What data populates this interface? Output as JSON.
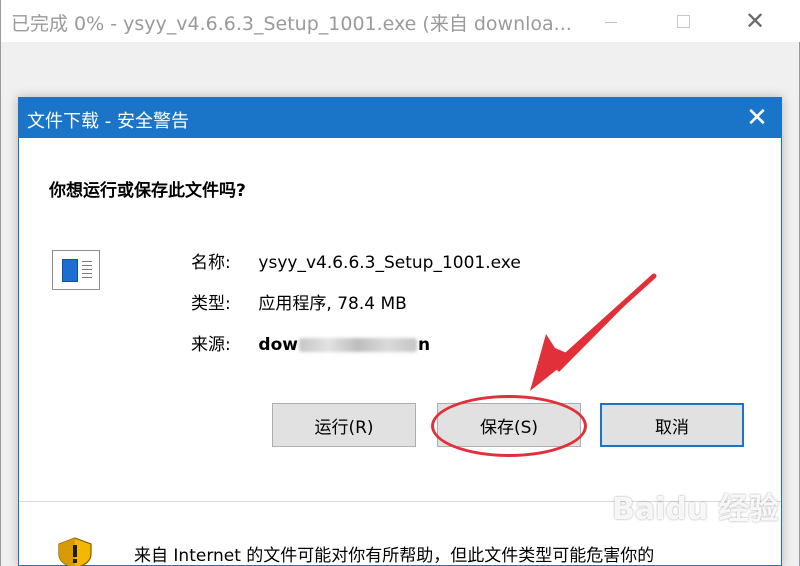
{
  "outer_window": {
    "title": "已完成 0% - ysyy_v4.6.6.3_Setup_1001.exe (来自 downloa..."
  },
  "dialog": {
    "title": "文件下载 - 安全警告",
    "question": "你想运行或保存此文件吗?",
    "file": {
      "name_label": "名称:",
      "name_value": "ysyy_v4.6.6.3_Setup_1001.exe",
      "type_label": "类型:",
      "type_value": "应用程序, 78.4 MB",
      "source_label": "来源:",
      "source_value_start": "dow",
      "source_value_end": "n"
    },
    "buttons": {
      "run": "运行(R)",
      "save": "保存(S)",
      "cancel": "取消"
    },
    "warning_text": "来自 Internet 的文件可能对你有所帮助，但此文件类型可能危害你的"
  },
  "colors": {
    "accent": "#1a75c9",
    "annotation": "#e2303a"
  },
  "icons": {
    "file": "file-icon",
    "shield": "shield-warning-icon",
    "close": "close-icon"
  },
  "watermark": "Baidu 经验"
}
